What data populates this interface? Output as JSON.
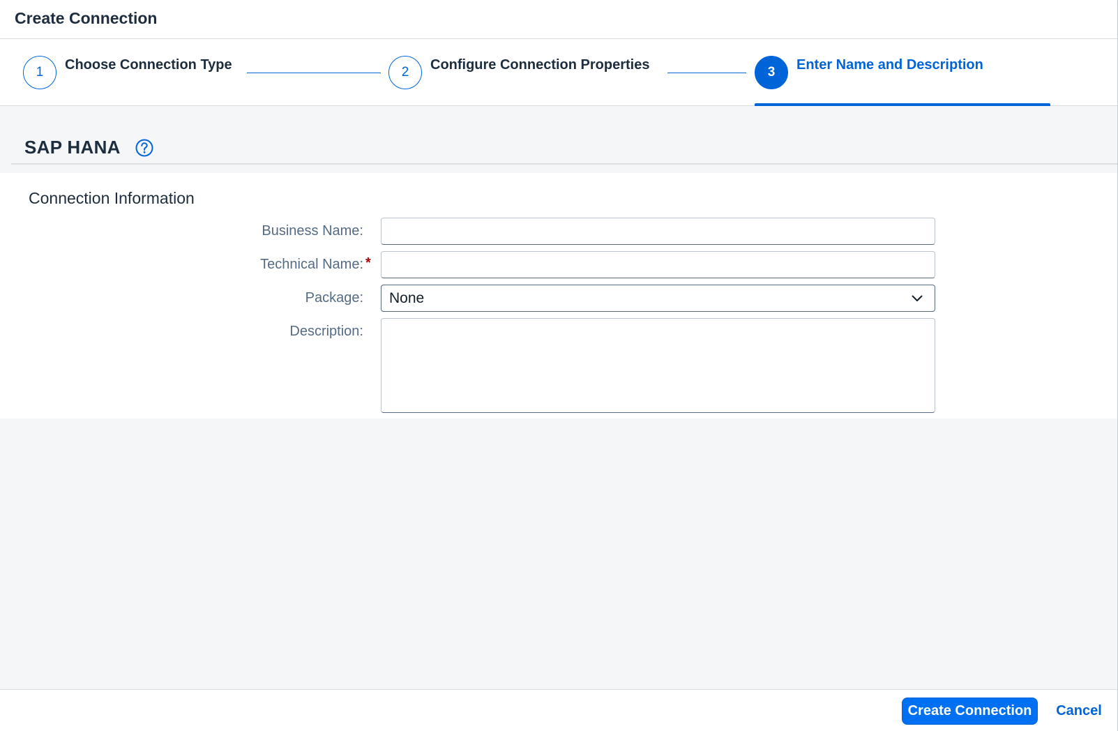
{
  "dialog": {
    "title": "Create Connection"
  },
  "wizard": {
    "steps": [
      {
        "number": "1",
        "label": "Choose Connection Type",
        "state": "completed"
      },
      {
        "number": "2",
        "label": "Configure Connection Properties",
        "state": "completed"
      },
      {
        "number": "3",
        "label": "Enter Name and Description",
        "state": "active"
      }
    ],
    "accent_color": "#0064d9"
  },
  "section": {
    "title": "SAP HANA",
    "help_icon": "help-circle-icon"
  },
  "form": {
    "heading": "Connection Information",
    "business_name": {
      "label": "Business Name:",
      "value": ""
    },
    "technical_name": {
      "label": "Technical Name:",
      "value": "",
      "required_marker": "*"
    },
    "package": {
      "label": "Package:",
      "value": "None"
    },
    "description": {
      "label": "Description:",
      "value": ""
    }
  },
  "footer": {
    "create_label": "Create Connection",
    "cancel_label": "Cancel",
    "primary_color": "#0070f2"
  }
}
